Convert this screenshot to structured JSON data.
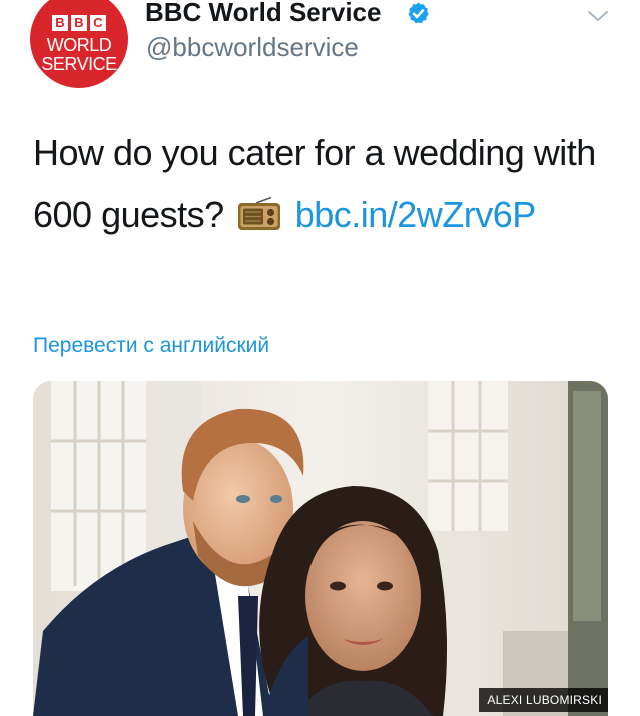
{
  "author": {
    "avatar_logo": "BBC",
    "avatar_line1": "WORLD",
    "avatar_line2": "SERVICE",
    "display_name": "BBC World Service",
    "handle": "@bbcworldservice",
    "verified_icon": "verified-badge-icon",
    "verified_color": "#1da1f2"
  },
  "tweet": {
    "text": "How do you cater for a wedding with 600 guests?",
    "emoji_icon": "radio-icon",
    "link_text": "bbc.in/2wZrv6P",
    "link_color": "#1b95e0",
    "translate_label": "Перевести с английский"
  },
  "media": {
    "photo_credit": "ALEXI LUBOMIRSKI"
  },
  "menu_icon": "chevron-down-icon"
}
